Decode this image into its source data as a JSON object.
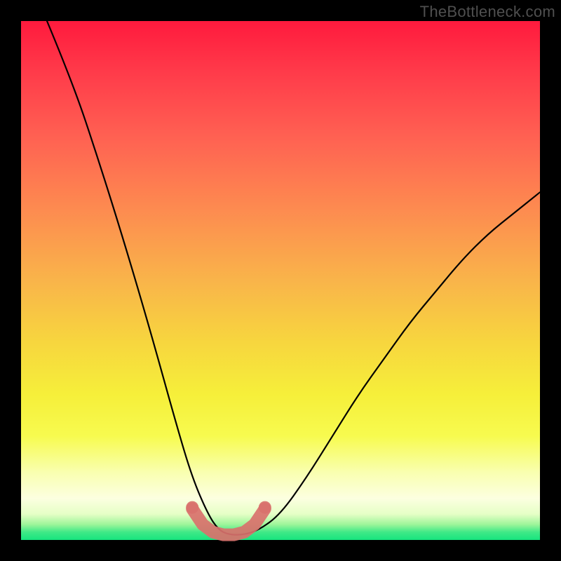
{
  "watermark": "TheBottleneck.com",
  "chart_data": {
    "type": "line",
    "title": "",
    "xlabel": "",
    "ylabel": "",
    "xlim": [
      0,
      1
    ],
    "ylim": [
      0,
      1
    ],
    "series": [
      {
        "name": "bottleneck-curve",
        "x": [
          0.05,
          0.1,
          0.15,
          0.2,
          0.25,
          0.3,
          0.33,
          0.36,
          0.38,
          0.4,
          0.43,
          0.46,
          0.5,
          0.55,
          0.6,
          0.65,
          0.7,
          0.75,
          0.8,
          0.85,
          0.9,
          0.95,
          1.0
        ],
        "y": [
          1.0,
          0.88,
          0.73,
          0.57,
          0.4,
          0.22,
          0.12,
          0.05,
          0.02,
          0.01,
          0.01,
          0.02,
          0.05,
          0.12,
          0.2,
          0.28,
          0.35,
          0.42,
          0.48,
          0.54,
          0.59,
          0.63,
          0.67
        ]
      },
      {
        "name": "trough-marker",
        "x": [
          0.33,
          0.35,
          0.37,
          0.39,
          0.41,
          0.43,
          0.45,
          0.47
        ],
        "y": [
          0.06,
          0.03,
          0.015,
          0.01,
          0.01,
          0.015,
          0.03,
          0.06
        ]
      }
    ],
    "annotations": []
  },
  "colors": {
    "curve": "#000000",
    "marker": "#d9716d",
    "background_top": "#ff1a3d",
    "background_bottom": "#17e47e"
  }
}
